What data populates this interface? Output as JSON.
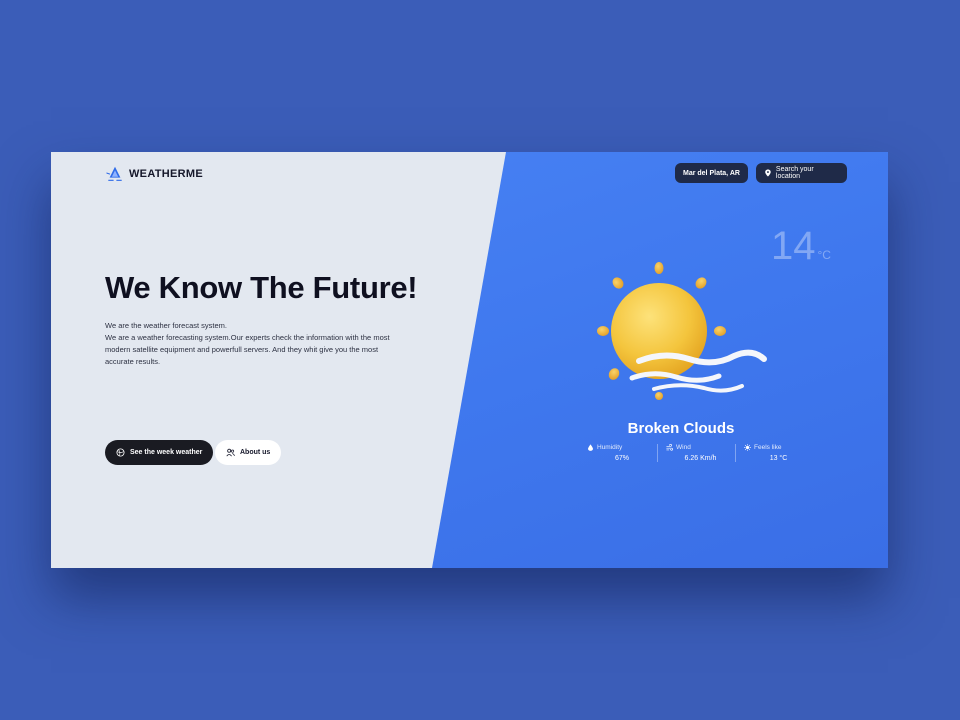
{
  "brand": {
    "name": "WEATHERME",
    "icon": "snowflake-logo-icon"
  },
  "header": {
    "location": "Mar del Plata, AR",
    "search_label": "Search your location"
  },
  "hero": {
    "title": "We Know The Future!",
    "desc_line1": "We are the weather forecast system.",
    "desc_line2": "We are a weather forecasting system.Our experts check the information with the most modern satellite equipment and powerfull servers. And they whit give you the most accurate results."
  },
  "actions": {
    "week_weather": "See the week weather",
    "about_us": "About us"
  },
  "weather": {
    "temperature": "14",
    "unit": "°C",
    "condition": "Broken Clouds",
    "illustration_icon": "sun-with-wind-icon",
    "stats": [
      {
        "label": "Humidity",
        "value": "67%",
        "icon": "droplet-icon"
      },
      {
        "label": "Wind",
        "value": "6.26 Km/h",
        "icon": "wind-icon"
      },
      {
        "label": "Feels like",
        "value": "13 °C",
        "icon": "sun-small-icon"
      }
    ]
  },
  "colors": {
    "page_bg": "#3b5db8",
    "left_panel": "#e3e8f0",
    "right_panel": "#4a84f5",
    "dark_button": "#1a1b22",
    "pill": "#1f2a48"
  }
}
